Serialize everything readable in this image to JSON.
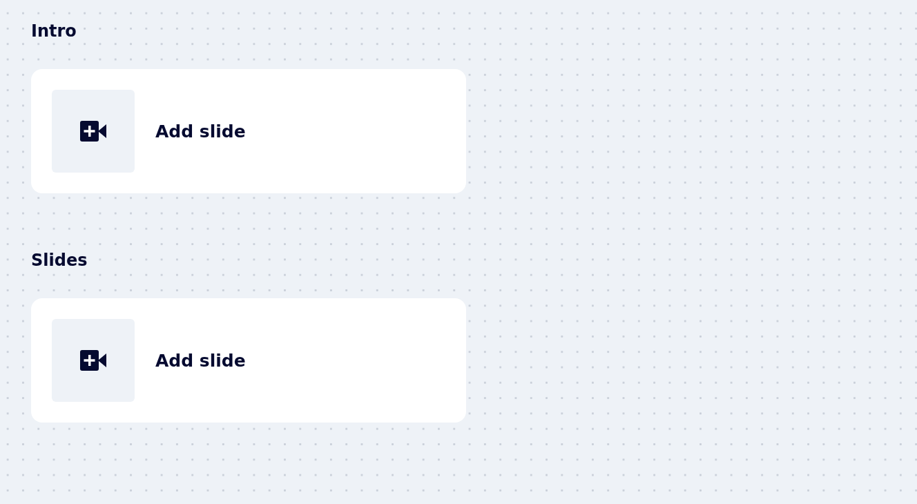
{
  "sections": [
    {
      "title": "Intro",
      "cards": [
        {
          "label": "Add slide"
        }
      ]
    },
    {
      "title": "Slides",
      "cards": [
        {
          "label": "Add slide"
        }
      ]
    }
  ]
}
